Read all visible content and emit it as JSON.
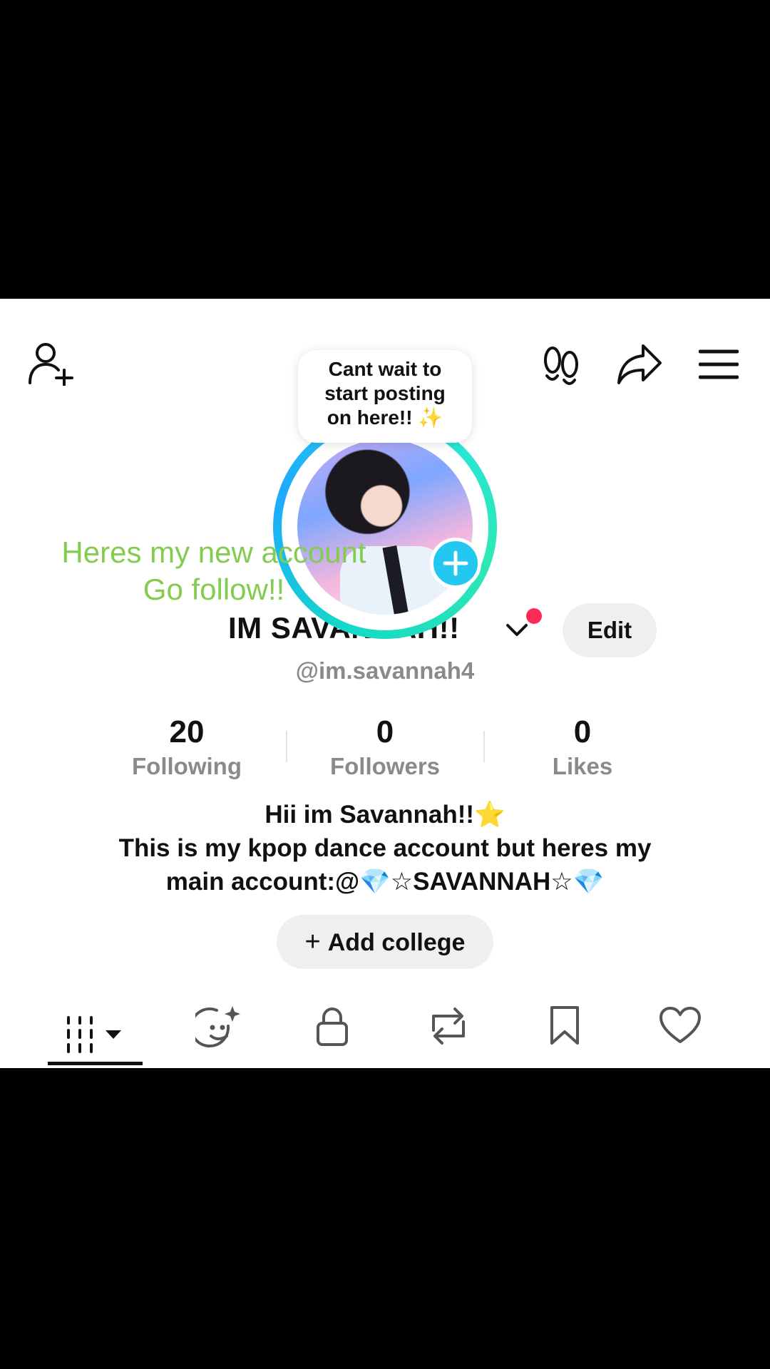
{
  "header": {
    "add_friend_icon": "person-plus-icon",
    "footprints_icon": "footprints-icon",
    "share_icon": "share-arrow-icon",
    "menu_icon": "hamburger-menu-icon"
  },
  "note_bubble": {
    "lines": [
      "Cant wait to",
      "start posting",
      "on here!! ✨"
    ]
  },
  "overlay_caption": {
    "lines": [
      "Heres my new account",
      "Go follow!!"
    ]
  },
  "profile": {
    "display_name": "IM SAVANNAH!!",
    "username": "@im.savannah4",
    "edit_label": "Edit",
    "avatar_add_icon": "plus-icon"
  },
  "stats": [
    {
      "value": "20",
      "label": "Following"
    },
    {
      "value": "0",
      "label": "Followers"
    },
    {
      "value": "0",
      "label": "Likes"
    }
  ],
  "bio": {
    "lines": [
      "Hii im Savannah!!⭐",
      "This is my kpop dance account but heres my",
      "main account:@💎☆SAVANNAH☆💎"
    ]
  },
  "add_college": {
    "label": "Add college"
  },
  "tabs": [
    {
      "icon": "grid-videos-icon",
      "selected": true
    },
    {
      "icon": "sparkle-face-icon",
      "selected": false
    },
    {
      "icon": "lock-icon",
      "selected": false
    },
    {
      "icon": "repost-icon",
      "selected": false
    },
    {
      "icon": "bookmark-icon",
      "selected": false
    },
    {
      "icon": "heart-icon",
      "selected": false
    }
  ],
  "colors": {
    "accent_ring": "#1fa8ff",
    "add_button": "#24c7ef",
    "notification": "#fe2c55",
    "overlay_text": "#84cc4f"
  }
}
